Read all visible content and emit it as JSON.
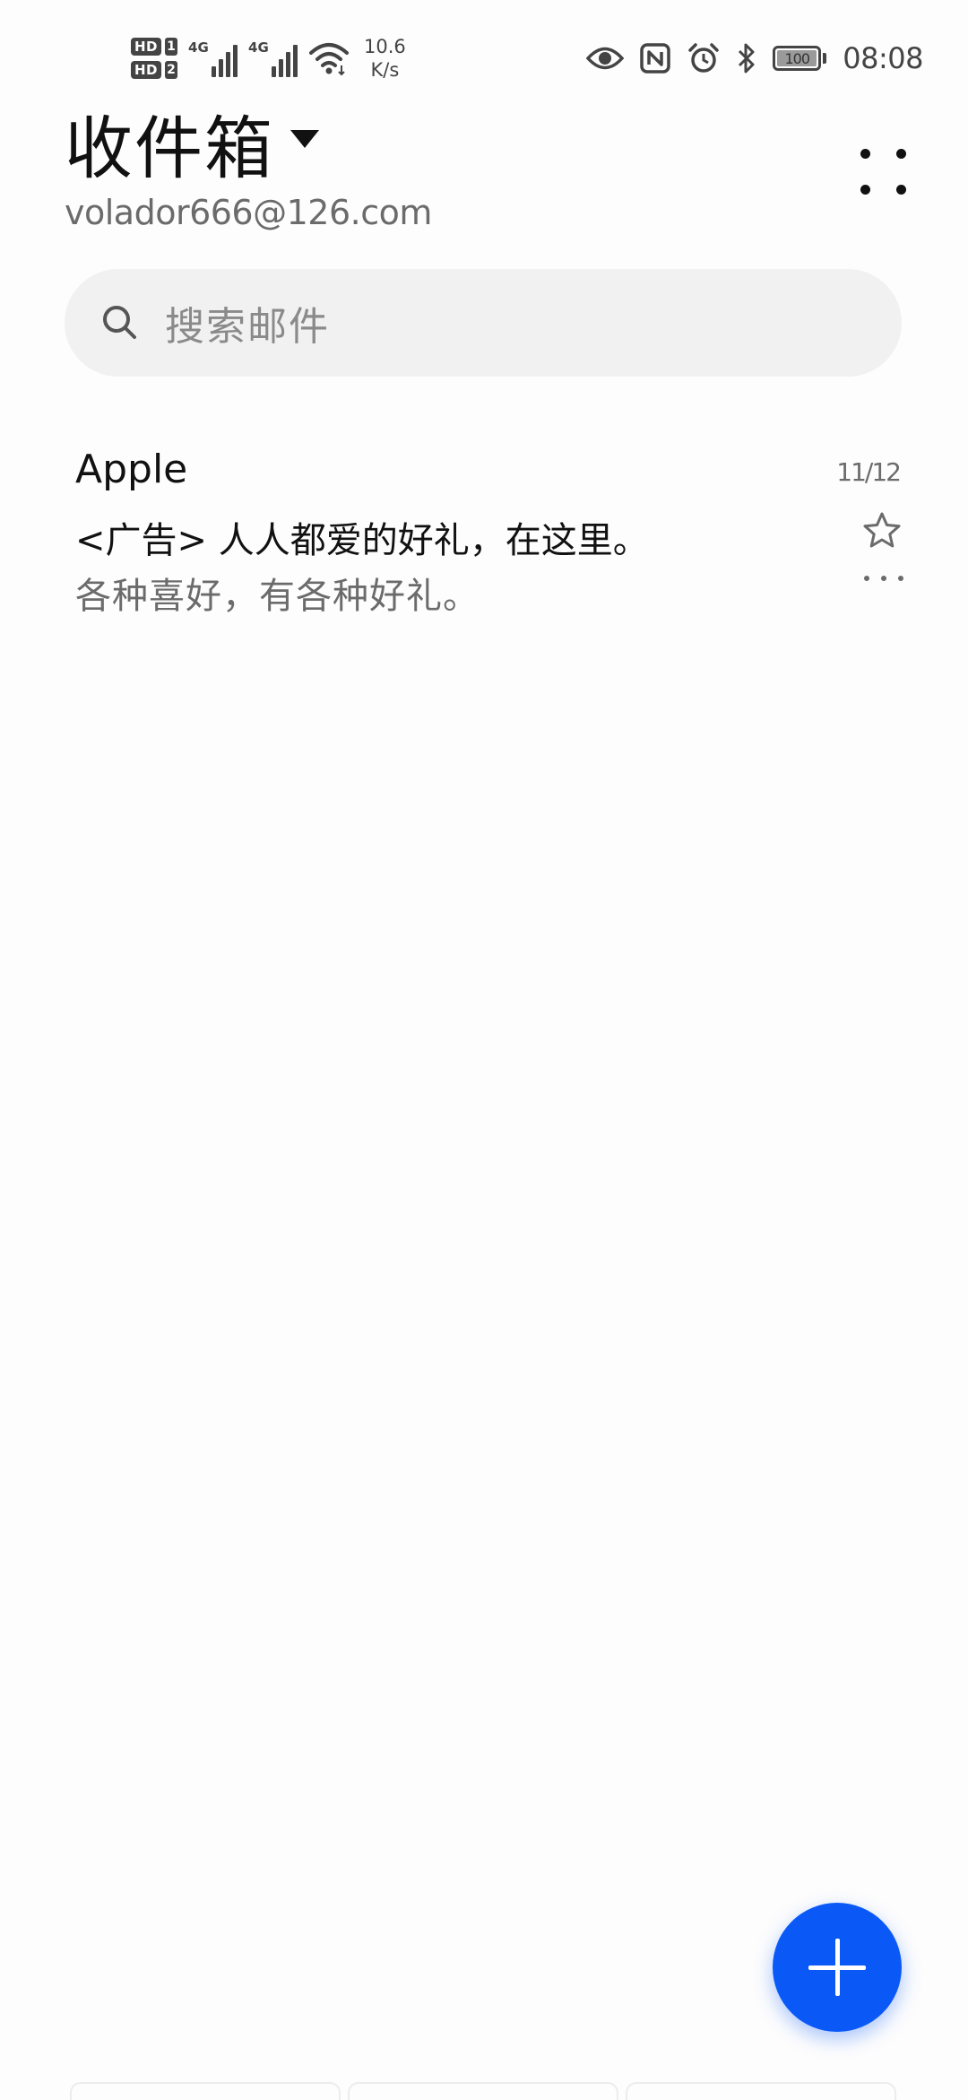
{
  "status_bar": {
    "sim1_label": "HD",
    "sim1_index": "1",
    "sim2_label": "HD",
    "sim2_index": "2",
    "sim1_network": "4G",
    "sim2_network": "4G",
    "net_speed_value": "10.6",
    "net_speed_unit": "K/s",
    "battery_level": "100",
    "time": "08:08",
    "icons": [
      "eye-comfort-icon",
      "nfc-icon",
      "alarm-icon",
      "bluetooth-icon",
      "wifi-icon",
      "signal-icon"
    ]
  },
  "header": {
    "title": "收件箱",
    "account_email": "volador666@126.com"
  },
  "search": {
    "placeholder": "搜索邮件"
  },
  "mail_list": [
    {
      "sender": "Apple",
      "date": "11/12",
      "subject": "<广告> 人人都爱的好礼，在这里。",
      "preview": "各种喜好，有各种好礼。",
      "starred": false
    }
  ],
  "colors": {
    "accent": "#0a59f7",
    "title_text": "#111111",
    "secondary_text": "#6b6b6b",
    "search_background": "#f1f1f1",
    "page_background": "#fdfdfd"
  }
}
